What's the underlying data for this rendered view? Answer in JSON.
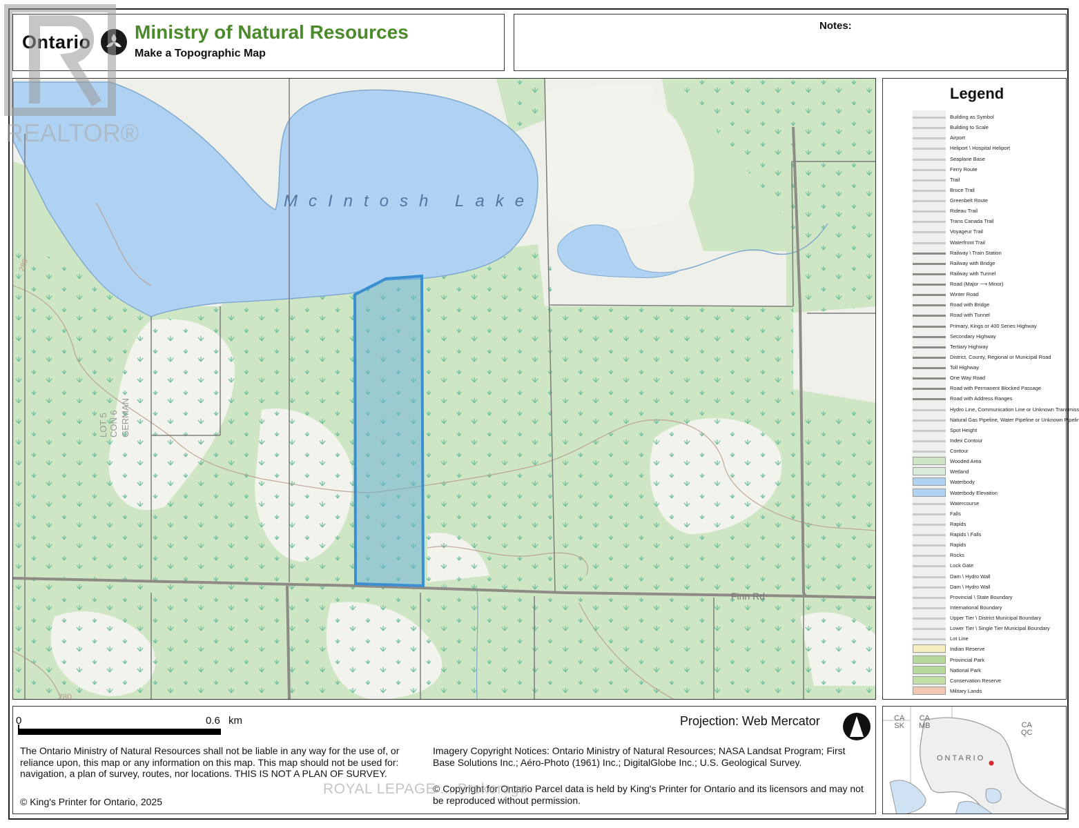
{
  "header": {
    "brand": "Ontario",
    "ministry": "Ministry of Natural Resources",
    "subtitle": "Make a Topographic Map"
  },
  "notes": {
    "label": "Notes:"
  },
  "watermark": {
    "realtor": "REALTOR®",
    "agency": "ROYAL LEPAGE ... Brokerage"
  },
  "map": {
    "lake_label": "McIntosh Lake",
    "road_label": "Finn Rd",
    "lot_label_1": "LOT 5",
    "lot_label_2": "CON 6",
    "lot_label_3": "GERMAN",
    "contour_280_a": "280",
    "contour_280_b": "280",
    "colors": {
      "water": "#b0d2f2",
      "woods": "#cfe6c4",
      "open": "#eff0ea",
      "parcel": "#3a8fd0",
      "road": "#8e8a86"
    }
  },
  "legend": {
    "title": "Legend",
    "items": [
      "Building as Symbol",
      "Building to Scale",
      "Airport",
      "Heliport \\ Hospital Heliport",
      "Seaplane Base",
      "Ferry Route",
      "Trail",
      "Bruce Trail",
      "Greenbelt Route",
      "Rideau Trail",
      "Trans Canada Trail",
      "Voyageur Trail",
      "Waterfront Trail",
      "Railway \\ Train Station",
      "Railway with Bridge",
      "Railway with Tunnel",
      "Road (Major ⟶ Minor)",
      "Winter Road",
      "Road with Bridge",
      "Road with Tunnel",
      "Primary, Kings or 400 Series Highway",
      "Secondary Highway",
      "Tertiary Highway",
      "District, County, Regional or Municipal Road",
      "Toll Highway",
      "One Way Road",
      "Road with Permanent Blocked Passage",
      "Road with Address Ranges",
      "Hydro Line, Communication Line or Unknown Transmission Line",
      "Natural Gas Pipeline, Water Pipeline or Unknown Pipeline",
      "Spot Height",
      "Index Contour",
      "Contour",
      "Wooded Area",
      "Wetland",
      "Waterbody",
      "Waterbody Elevation",
      "Watercourse",
      "Falls",
      "Rapids",
      "Rapids \\ Falls",
      "Rapids",
      "Rocks",
      "Lock Gate",
      "Dam \\ Hydro Wall",
      "Dam \\ Hydro Wall",
      "Provincial \\ State Boundary",
      "International Boundary",
      "Upper Tier \\ District Municipal Boundary",
      "Lower Tier \\ Single Tier Municipal Boundary",
      "Lot Line",
      "Indian Reserve",
      "Provincial Park",
      "National Park",
      "Conservation Reserve",
      "Military Lands"
    ]
  },
  "footer": {
    "scale_start": "0",
    "scale_end": "0.6",
    "scale_unit": "km",
    "projection": "Projection: Web Mercator",
    "disclaimer": "The Ontario Ministry of Natural Resources shall not be liable in any way for the use of, or reliance upon, this map or any information on this map.  This map should not be used for: navigation, a plan of survey, routes, nor locations. THIS IS NOT A PLAN OF SURVEY.",
    "imagery": "Imagery Copyright Notices: Ontario Ministry of Natural Resources; NASA Landsat Program; First Base Solutions Inc.; Aéro-Photo (1961) Inc.; DigitalGlobe Inc.; U.S. Geological Survey.",
    "parcel_copyright": "© Copyright for Ontario Parcel data is held by King's Printer for Ontario and its licensors and may not be reproduced without permission.",
    "kings_printer": "© King's Printer for Ontario,  2025"
  },
  "inset": {
    "ca_sk_1": "CA",
    "ca_sk_2": "SK",
    "ca_mb_1": "CA",
    "ca_mb_2": "MB",
    "ca_qc_1": "CA",
    "ca_qc_2": "QC",
    "province": "ONTARIO"
  }
}
